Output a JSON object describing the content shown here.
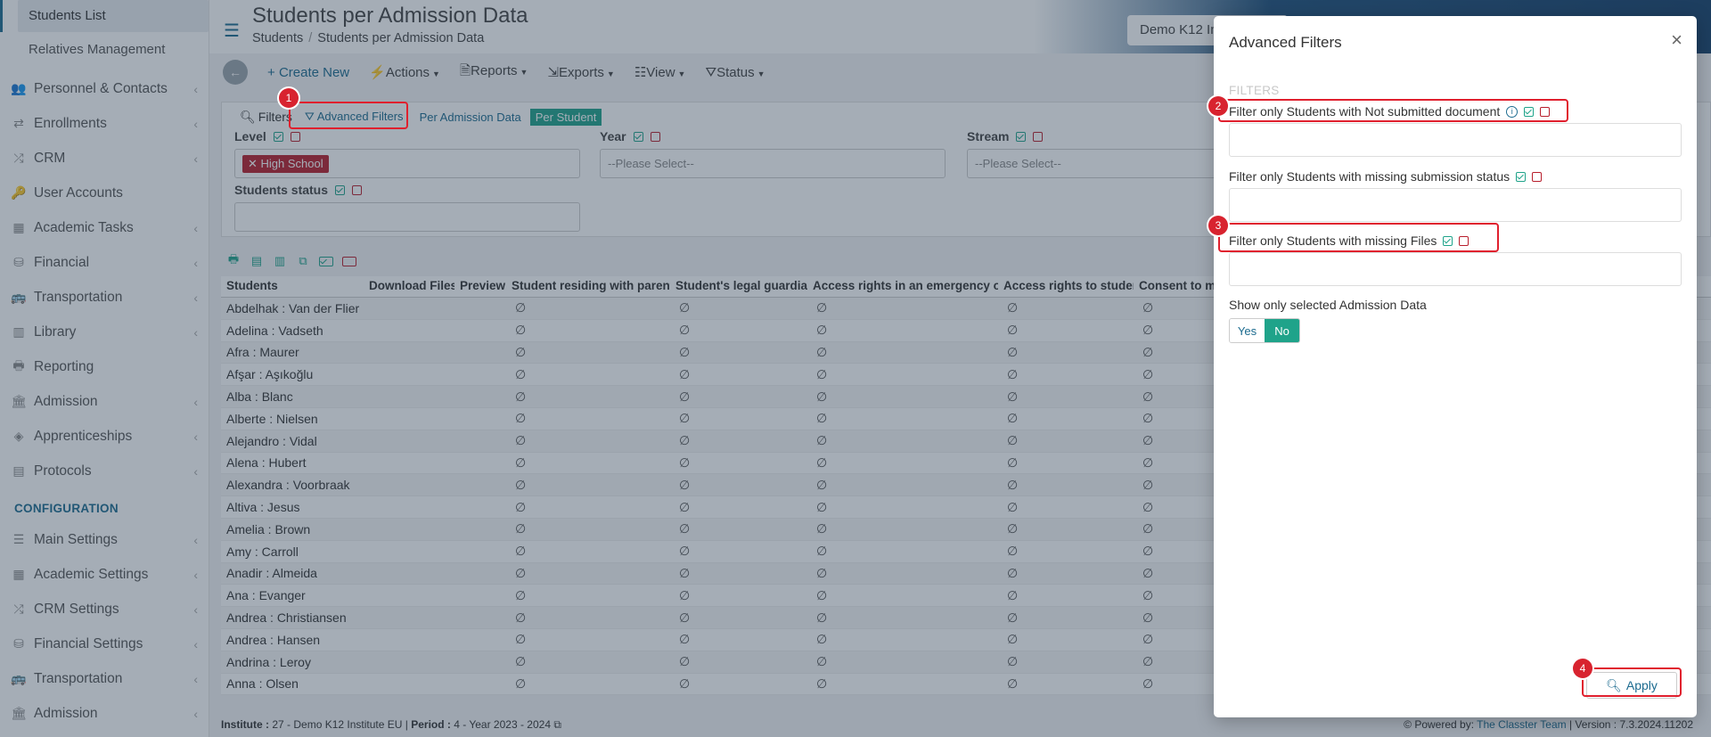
{
  "sidebar": {
    "sub_items": [
      "Students List",
      "Relatives Management"
    ],
    "items": [
      {
        "label": "Personnel & Contacts",
        "icon": "users-icon",
        "glyph": "👥"
      },
      {
        "label": "Enrollments",
        "icon": "exchange-icon",
        "glyph": "⇄"
      },
      {
        "label": "CRM",
        "icon": "branch-icon",
        "glyph": "⤮"
      },
      {
        "label": "User Accounts",
        "icon": "key-icon",
        "glyph": "🔑"
      },
      {
        "label": "Academic Tasks",
        "icon": "grid-icon",
        "glyph": "▦"
      },
      {
        "label": "Financial",
        "icon": "coins-icon",
        "glyph": "⛁"
      },
      {
        "label": "Transportation",
        "icon": "bus-icon",
        "glyph": "🚌"
      },
      {
        "label": "Library",
        "icon": "books-icon",
        "glyph": "▥"
      },
      {
        "label": "Reporting",
        "icon": "printer-icon",
        "glyph": "🖶"
      },
      {
        "label": "Admission",
        "icon": "building-icon",
        "glyph": "🏛"
      },
      {
        "label": "Apprenticeships",
        "icon": "cube-icon",
        "glyph": "◈"
      },
      {
        "label": "Protocols",
        "icon": "folder-icon",
        "glyph": "▤"
      }
    ],
    "section": "CONFIGURATION",
    "config_items": [
      {
        "label": "Main Settings",
        "icon": "sliders-icon",
        "glyph": "☰"
      },
      {
        "label": "Academic Settings",
        "icon": "people-grid-icon",
        "glyph": "▦"
      },
      {
        "label": "CRM Settings",
        "icon": "branch-icon",
        "glyph": "⤮"
      },
      {
        "label": "Financial Settings",
        "icon": "coins-icon",
        "glyph": "⛁"
      },
      {
        "label": "Transportation",
        "icon": "bus-icon",
        "glyph": "🚌"
      },
      {
        "label": "Admission",
        "icon": "building-icon",
        "glyph": "🏛"
      }
    ]
  },
  "header": {
    "title": "Students per Admission Data",
    "breadcrumb": [
      "Students",
      "Students per Admission Data"
    ],
    "institute": "Demo K12 In"
  },
  "toolbar": {
    "create": "Create New",
    "actions": "Actions",
    "reports": "Reports",
    "exports": "Exports",
    "view": "View",
    "status": "Status"
  },
  "filters": {
    "label": "Filters",
    "advanced": "Advanced Filters",
    "per_admission": "Per Admission Data",
    "per_student": "Per Student",
    "level_label": "Level",
    "level_tag": "High School",
    "year_label": "Year",
    "year_placeholder": "--Please Select--",
    "stream_label": "Stream",
    "stream_placeholder": "--Please Select--",
    "status_label": "Students status"
  },
  "table": {
    "columns": [
      "Students",
      "Download Files",
      "Preview",
      "Student residing with parents",
      "Student's legal guardian",
      "Access rights in an emergency only",
      "Access rights to student",
      "Consent to me"
    ],
    "empty_symbol": "∅",
    "rows": [
      "Abdelhak : Van der Flier",
      "Adelina : Vadseth",
      "Afra : Maurer",
      "Afşar : Aşıkoğlu",
      "Alba : Blanc",
      "Alberte : Nielsen",
      "Alejandro : Vidal",
      "Alena : Hubert",
      "Alexandra : Voorbraak",
      "Altiva : Jesus",
      "Amelia : Brown",
      "Amy : Carroll",
      "Anadir : Almeida",
      "Ana : Evanger",
      "Andrea : Christiansen",
      "Andrea : Hansen",
      "Andrina : Leroy",
      "Anna : Olsen"
    ]
  },
  "footer": {
    "institute_label": "Institute :",
    "institute_value": "27 - Demo K12 Institute EU",
    "period_label": "Period :",
    "period_value": "4 - Year 2023 - 2024",
    "powered_label": "Powered by:",
    "powered_link": "The Classter Team",
    "version": "| Version : 7.3.2024.11202"
  },
  "modal": {
    "title": "Advanced Filters",
    "section": "FILTERS",
    "filter1": "Filter only Students with Not submitted document",
    "filter2": "Filter only Students with missing submission status",
    "filter3": "Filter only Students with missing Files",
    "show_selected": "Show only selected Admission Data",
    "yes": "Yes",
    "no": "No",
    "apply": "Apply"
  },
  "annotations": [
    "1",
    "2",
    "3",
    "4"
  ],
  "colors": {
    "primary": "#1c6b8f",
    "green": "#1fa38a",
    "red": "#b81e2c",
    "annotation": "#e0202e"
  }
}
